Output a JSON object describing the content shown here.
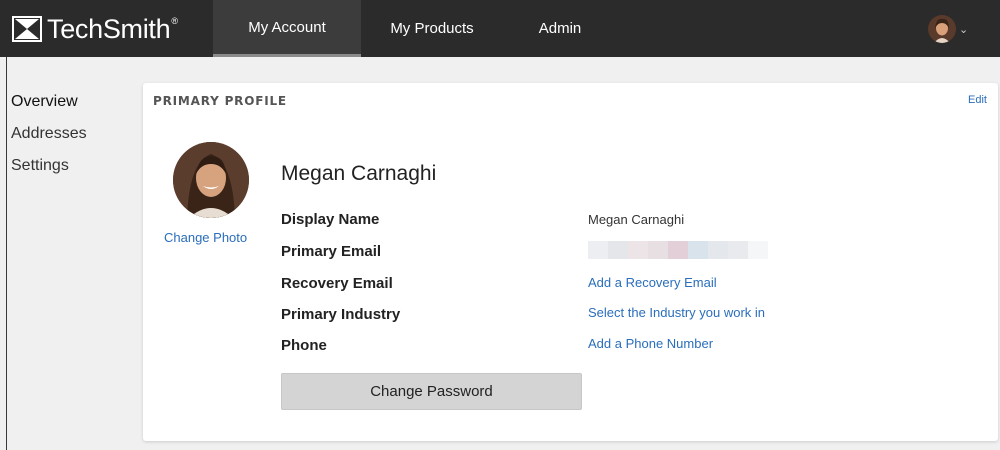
{
  "header": {
    "brand": "TechSmith",
    "brand_mark": "®",
    "tabs": [
      "My Account",
      "My Products",
      "Admin"
    ],
    "active_tab": "My Account"
  },
  "sidebar": {
    "items": [
      {
        "label": "Overview",
        "active": true
      },
      {
        "label": "Addresses",
        "active": false
      },
      {
        "label": "Settings",
        "active": false
      }
    ]
  },
  "profile": {
    "heading": "PRIMARY PROFILE",
    "edit_label": "Edit",
    "change_photo_label": "Change Photo",
    "name": "Megan Carnaghi",
    "fields": [
      {
        "label": "Display Name",
        "value": "Megan Carnaghi",
        "is_link": false
      },
      {
        "label": "Primary Email",
        "value": "",
        "is_link": false
      },
      {
        "label": "Recovery Email",
        "value": "Add a Recovery Email",
        "is_link": true
      },
      {
        "label": "Primary Industry",
        "value": "Select the Industry you work in",
        "is_link": true
      },
      {
        "label": "Phone",
        "value": "Add a Phone Number",
        "is_link": true
      }
    ],
    "change_password_label": "Change Password"
  },
  "colors": {
    "topbar": "#2b2b2b",
    "link": "#2a6ebb",
    "button": "#d4d4d4"
  }
}
